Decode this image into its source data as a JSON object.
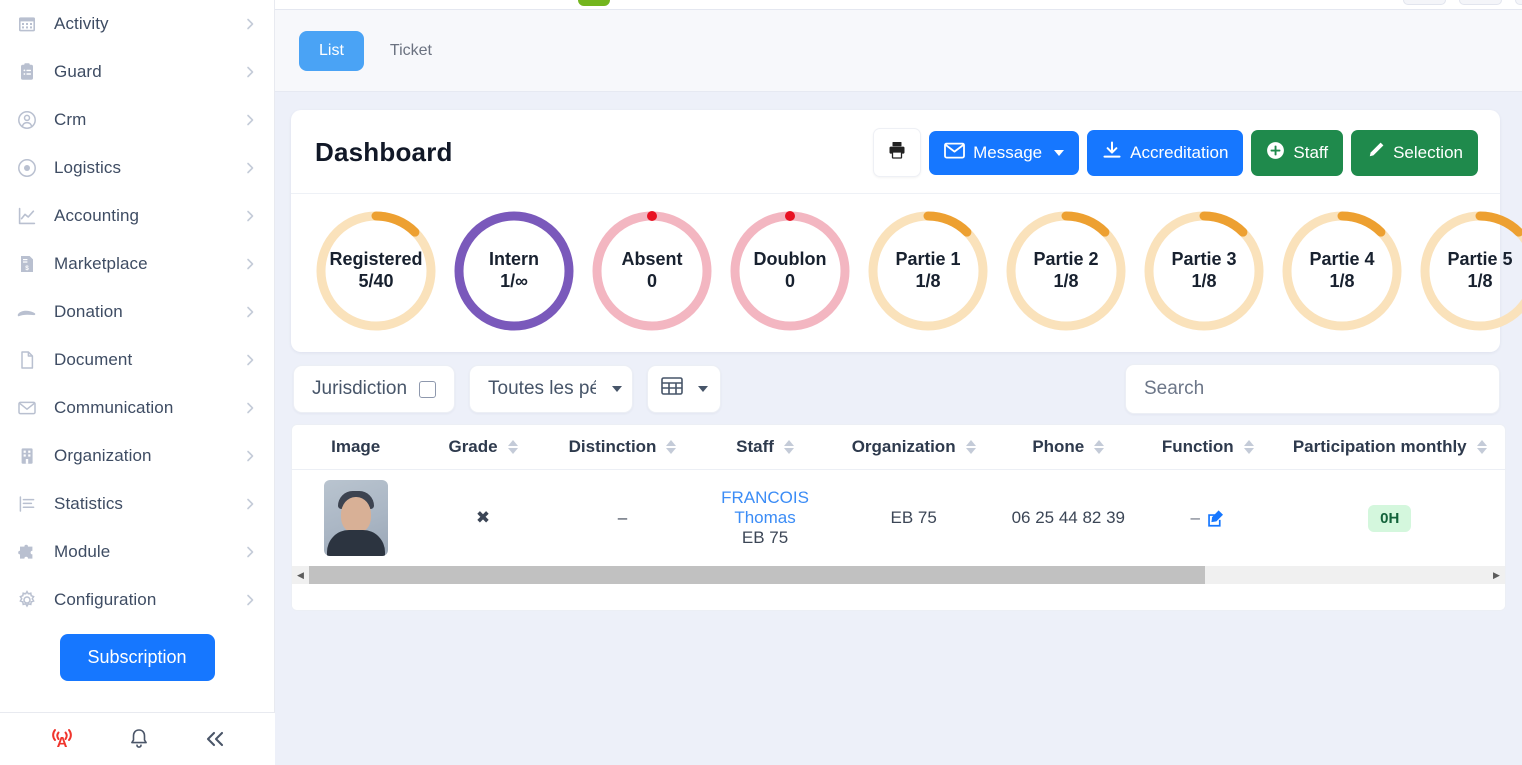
{
  "sidebar": {
    "items": [
      {
        "label": "Activity",
        "icon": "calendar-icon"
      },
      {
        "label": "Guard",
        "icon": "clipboard-icon"
      },
      {
        "label": "Crm",
        "icon": "user-circle-icon"
      },
      {
        "label": "Logistics",
        "icon": "target-icon"
      },
      {
        "label": "Accounting",
        "icon": "chart-line-icon"
      },
      {
        "label": "Marketplace",
        "icon": "invoice-icon"
      },
      {
        "label": "Donation",
        "icon": "hand-holding-icon"
      },
      {
        "label": "Document",
        "icon": "file-icon"
      },
      {
        "label": "Communication",
        "icon": "envelope-icon"
      },
      {
        "label": "Organization",
        "icon": "building-icon"
      },
      {
        "label": "Statistics",
        "icon": "list-bars-icon"
      },
      {
        "label": "Module",
        "icon": "puzzle-icon"
      },
      {
        "label": "Configuration",
        "icon": "gear-icon"
      }
    ],
    "subscription_label": "Subscription",
    "footer": {
      "antenna_icon": "antenna-broadcast-icon",
      "bell_icon": "bell-icon",
      "collapse_icon": "chevron-double-left-icon",
      "antenna_color": "#f0342c"
    }
  },
  "tabs": [
    {
      "label": "List",
      "active": true
    },
    {
      "label": "Ticket",
      "active": false
    }
  ],
  "dashboard": {
    "title": "Dashboard",
    "actions": {
      "print_icon": "printer-icon",
      "message_label": "Message",
      "message_icon": "envelope-icon",
      "accreditation_label": "Accreditation",
      "accreditation_icon": "download-icon",
      "staff_label": "Staff",
      "staff_icon": "plus-circle-icon",
      "selection_label": "Selection",
      "selection_icon": "pencil-icon"
    },
    "colors": {
      "blue": "#1677ff",
      "green": "#1f8a4c",
      "orange": "#eda031",
      "orange_track": "#fae2bb",
      "purple": "#7a59bb",
      "pink": "#f3b6c1",
      "red_dot": "#e81123",
      "tab_active": "#4aa3f5"
    }
  },
  "stats": [
    {
      "label": "Registered",
      "value": "5/40",
      "ring": "orange",
      "percent": 12.5,
      "dot": false
    },
    {
      "label": "Intern",
      "value": "1/∞",
      "ring": "purple",
      "percent": 100,
      "dot": false
    },
    {
      "label": "Absent",
      "value": "0",
      "ring": "pink",
      "percent": 0,
      "dot": true
    },
    {
      "label": "Doublon",
      "value": "0",
      "ring": "pink",
      "percent": 0,
      "dot": true
    },
    {
      "label": "Partie 1",
      "value": "1/8",
      "ring": "orange",
      "percent": 12.5,
      "dot": false
    },
    {
      "label": "Partie 2",
      "value": "1/8",
      "ring": "orange",
      "percent": 12.5,
      "dot": false
    },
    {
      "label": "Partie 3",
      "value": "1/8",
      "ring": "orange",
      "percent": 12.5,
      "dot": false
    },
    {
      "label": "Partie 4",
      "value": "1/8",
      "ring": "orange",
      "percent": 12.5,
      "dot": false
    },
    {
      "label": "Partie 5",
      "value": "1/8",
      "ring": "orange",
      "percent": 12.5,
      "dot": false
    }
  ],
  "filters": {
    "jurisdiction_label": "Jurisdiction",
    "jurisdiction_checked": false,
    "period_label": "Toutes les péri",
    "columns_icon": "table-columns-icon"
  },
  "search": {
    "placeholder": "Search",
    "value": ""
  },
  "table": {
    "columns": [
      {
        "label": "Image",
        "sortable": false
      },
      {
        "label": "Grade",
        "sortable": true
      },
      {
        "label": "Distinction",
        "sortable": true
      },
      {
        "label": "Staff",
        "sortable": true
      },
      {
        "label": "Organization",
        "sortable": true
      },
      {
        "label": "Phone",
        "sortable": true
      },
      {
        "label": "Function",
        "sortable": true
      },
      {
        "label": "Participation monthly",
        "sortable": true
      }
    ],
    "rows": [
      {
        "image": "staff-photo",
        "grade": "✖",
        "distinction": "–",
        "staff_name": "FRANCOIS Thomas",
        "staff_org": "EB 75",
        "organization": "EB 75",
        "phone": "06 25 44 82 39",
        "function": "–",
        "function_edit_icon": "edit-pencil-icon",
        "participation_monthly": "0H"
      }
    ],
    "scrollbar": {
      "left_arrow_icon": "triangle-left-icon",
      "right_arrow_icon": "triangle-right-icon",
      "thumb_percent": 76
    }
  }
}
